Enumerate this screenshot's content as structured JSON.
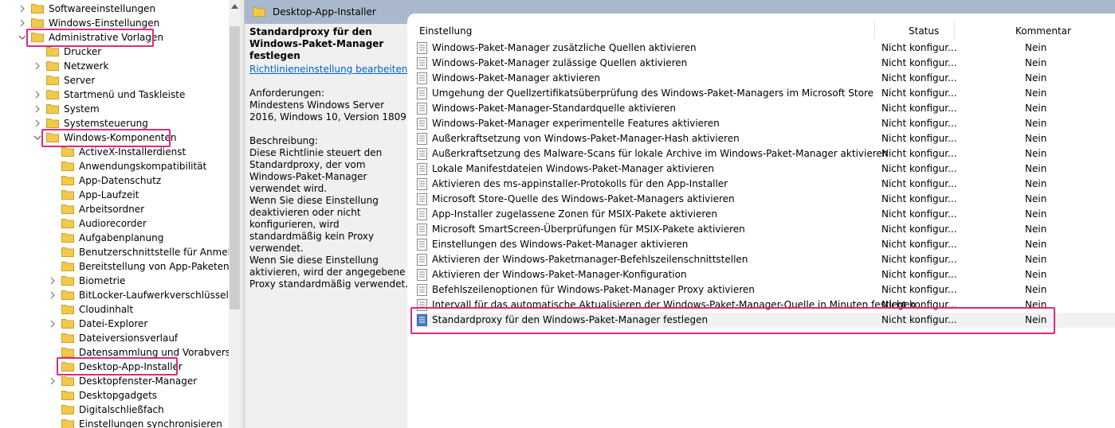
{
  "tree": {
    "items": [
      {
        "label": "Softwareeinstellungen",
        "expander": "right"
      },
      {
        "label": "Windows-Einstellungen",
        "expander": "right"
      },
      {
        "label": "Administrative Vorlagen",
        "expander": "down"
      },
      {
        "label": "Drucker",
        "expander": "none"
      },
      {
        "label": "Netzwerk",
        "expander": "right"
      },
      {
        "label": "Server",
        "expander": "none"
      },
      {
        "label": "Startmenü und Taskleiste",
        "expander": "right"
      },
      {
        "label": "System",
        "expander": "right"
      },
      {
        "label": "Systemsteuerung",
        "expander": "right"
      },
      {
        "label": "Windows-Komponenten",
        "expander": "down"
      },
      {
        "label": "ActiveX-Installerdienst",
        "expander": "none"
      },
      {
        "label": "Anwendungskompatibilität",
        "expander": "none"
      },
      {
        "label": "App-Datenschutz",
        "expander": "none"
      },
      {
        "label": "App-Laufzeit",
        "expander": "none"
      },
      {
        "label": "Arbeitsordner",
        "expander": "none"
      },
      {
        "label": "Audiorecorder",
        "expander": "none"
      },
      {
        "label": "Aufgabenplanung",
        "expander": "none"
      },
      {
        "label": "Benutzerschnittstelle für Anmeldeir",
        "expander": "none"
      },
      {
        "label": "Bereitstellung von App-Paketen",
        "expander": "none"
      },
      {
        "label": "Biometrie",
        "expander": "right"
      },
      {
        "label": "BitLocker-Laufwerkverschlüsselung",
        "expander": "right"
      },
      {
        "label": "Cloudinhalt",
        "expander": "none"
      },
      {
        "label": "Datei-Explorer",
        "expander": "right"
      },
      {
        "label": "Dateiversionsverlauf",
        "expander": "none"
      },
      {
        "label": "Datensammlung und Vorabversione",
        "expander": "none"
      },
      {
        "label": "Desktop-App-Installer",
        "expander": "none"
      },
      {
        "label": "Desktopfenster-Manager",
        "expander": "right"
      },
      {
        "label": "Desktopgadgets",
        "expander": "none"
      },
      {
        "label": "Digitalschließfach",
        "expander": "none"
      },
      {
        "label": "Einstellungen synchronisieren",
        "expander": "none"
      }
    ]
  },
  "header": {
    "title": "Desktop-App-Installer"
  },
  "description": {
    "title": "Standardproxy für den Windows-Paket-Manager festlegen",
    "edit_link": "Richtlinieneinstellung bearbeiten",
    "requirements_label": "Anforderungen:",
    "requirements": "Mindestens Windows Server 2016, Windows 10, Version 1809",
    "description_label": "Beschreibung:",
    "p1": "Diese Richtlinie steuert den Standardproxy, der vom Windows-Paket-Manager verwendet wird.",
    "p2": "Wenn Sie diese Einstellung deaktivieren oder nicht konfigurieren, wird standardmäßig kein Proxy verwendet.",
    "p3": "Wenn Sie diese Einstellung aktivieren, wird der angegebene Proxy standardmäßig verwendet."
  },
  "list": {
    "columns": {
      "setting": "Einstellung",
      "status": "Status",
      "comment": "Kommentar"
    },
    "rows": [
      {
        "name": "Windows-Paket-Manager zusätzliche Quellen aktivieren",
        "status": "Nicht konfigur...",
        "comment": "Nein"
      },
      {
        "name": "Windows-Paket-Manager zulässige Quellen aktivieren",
        "status": "Nicht konfigur...",
        "comment": "Nein"
      },
      {
        "name": "Windows-Paket-Manager aktivieren",
        "status": "Nicht konfigur...",
        "comment": "Nein"
      },
      {
        "name": "Umgehung der Quellzertifikatsüberprüfung des Windows-Paket-Managers im Microsoft Store",
        "status": "Nicht konfigur...",
        "comment": "Nein"
      },
      {
        "name": "Windows-Paket-Manager-Standardquelle aktivieren",
        "status": "Nicht konfigur...",
        "comment": "Nein"
      },
      {
        "name": "Windows-Paket-Manager experimentelle Features aktivieren",
        "status": "Nicht konfigur...",
        "comment": "Nein"
      },
      {
        "name": "Außerkraftsetzung von Windows-Paket-Manager-Hash aktivieren",
        "status": "Nicht konfigur...",
        "comment": "Nein"
      },
      {
        "name": "Außerkraftsetzung des Malware-Scans für lokale Archive im Windows-Paket-Manager aktivieren",
        "status": "Nicht konfigur...",
        "comment": "Nein"
      },
      {
        "name": "Lokale Manifestdateien Windows-Paket-Manager aktivieren",
        "status": "Nicht konfigur...",
        "comment": "Nein"
      },
      {
        "name": "Aktivieren des ms-appinstaller-Protokolls für den App-Installer",
        "status": "Nicht konfigur...",
        "comment": "Nein"
      },
      {
        "name": "Microsoft Store-Quelle des Windows-Paket-Managers aktivieren",
        "status": "Nicht konfigur...",
        "comment": "Nein"
      },
      {
        "name": "App-Installer zugelassene Zonen für MSIX-Pakete aktivieren",
        "status": "Nicht konfigur...",
        "comment": "Nein"
      },
      {
        "name": "Microsoft SmartScreen-Überprüfungen für MSIX-Pakete aktivieren",
        "status": "Nicht konfigur...",
        "comment": "Nein"
      },
      {
        "name": "Einstellungen des Windows-Paket-Manager aktivieren",
        "status": "Nicht konfigur...",
        "comment": "Nein"
      },
      {
        "name": "Aktivieren der Windows-Paketmanager-Befehlszeilenschnittstellen",
        "status": "Nicht konfigur...",
        "comment": "Nein"
      },
      {
        "name": "Aktivieren der Windows-Paket-Manager-Konfiguration",
        "status": "Nicht konfigur...",
        "comment": "Nein"
      },
      {
        "name": "Befehlszeilenoptionen für Windows-Paket-Manager Proxy aktivieren",
        "status": "Nicht konfigur...",
        "comment": "Nein"
      },
      {
        "name": "Intervall für das automatische Aktualisieren der Windows-Paket-Manager-Quelle in Minuten festlegen",
        "status": "Nicht konfigur...",
        "comment": "Nein"
      },
      {
        "name": "Standardproxy für den Windows-Paket-Manager festlegen",
        "status": "Nicht konfigur...",
        "comment": "Nein"
      }
    ]
  },
  "colors": {
    "highlight": "#e0287d",
    "header_bg": "#a9b8cc",
    "folder": "#f2c94c",
    "link": "#0066cc"
  }
}
